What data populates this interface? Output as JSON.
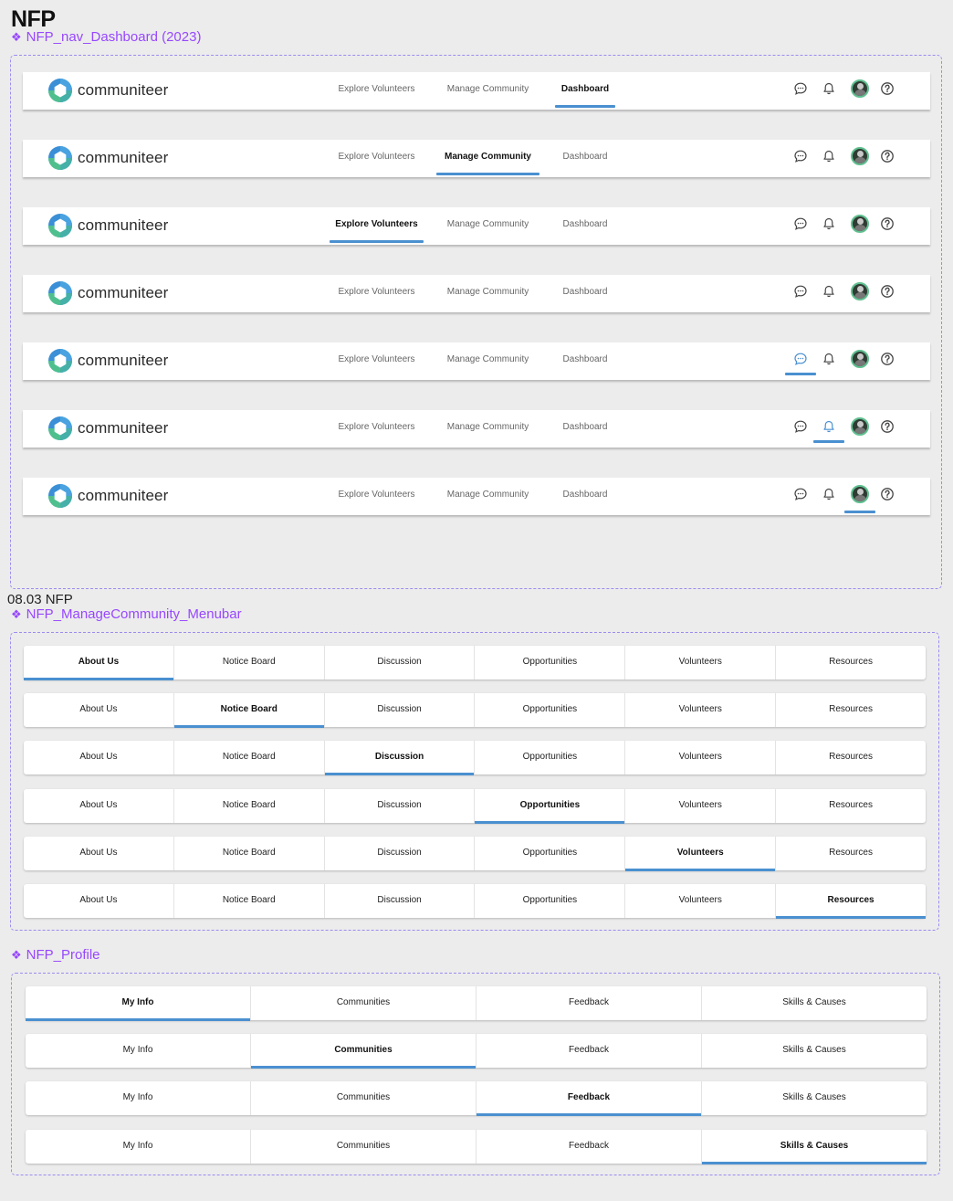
{
  "page_title": "NFP",
  "brand": {
    "name": "communiteer",
    "accent": "#4a90d0",
    "component_color": "#9747ff"
  },
  "sections": {
    "nav": {
      "component_label": "NFP_nav_Dashboard (2023)",
      "diamond": "❖"
    },
    "manage": {
      "title": "08.03 NFP",
      "component_label": "NFP_ManageCommunity_Menubar",
      "diamond": "❖"
    },
    "profile": {
      "component_label": "NFP_Profile",
      "diamond": "❖"
    }
  },
  "nav_links": [
    "Explore Volunteers",
    "Manage Community",
    "Dashboard"
  ],
  "nav_icons": [
    "chat-icon",
    "bell-icon",
    "avatar",
    "help-icon"
  ],
  "nav_variants": [
    {
      "active_link": 2,
      "active_icon": null
    },
    {
      "active_link": 1,
      "active_icon": null
    },
    {
      "active_link": 0,
      "active_icon": null
    },
    {
      "active_link": null,
      "active_icon": null
    },
    {
      "active_link": null,
      "active_icon": 0
    },
    {
      "active_link": null,
      "active_icon": 1
    },
    {
      "active_link": null,
      "active_icon": 2
    }
  ],
  "manage_tabs": [
    "About Us",
    "Notice Board",
    "Discussion",
    "Opportunities",
    "Volunteers",
    "Resources"
  ],
  "manage_variants": [
    0,
    1,
    2,
    3,
    4,
    5
  ],
  "profile_tabs": [
    "My Info",
    "Communities",
    "Feedback",
    "Skills & Causes"
  ],
  "profile_variants": [
    0,
    1,
    2,
    3
  ]
}
